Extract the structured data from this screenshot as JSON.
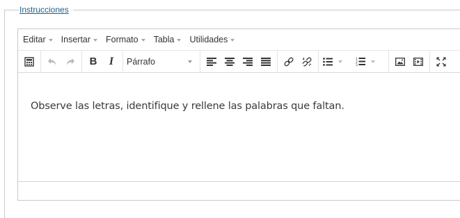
{
  "fieldset": {
    "legend": "Instrucciones"
  },
  "menubar": {
    "items": [
      {
        "label": "Editar"
      },
      {
        "label": "Insertar"
      },
      {
        "label": "Formato"
      },
      {
        "label": "Tabla"
      },
      {
        "label": "Utilidades"
      }
    ]
  },
  "toolbar": {
    "format_select_value": "Párrafo",
    "icons": {
      "source": "source-code-icon",
      "undo": "undo-icon",
      "redo": "redo-icon",
      "bold": "B",
      "italic": "I",
      "align_left": "align-left-icon",
      "align_center": "align-center-icon",
      "align_right": "align-right-icon",
      "align_justify": "align-justify-icon",
      "link": "link-icon",
      "unlink": "unlink-icon",
      "bullet_list": "bullet-list-icon",
      "numbered_list": "numbered-list-icon",
      "image": "image-icon",
      "media": "media-icon",
      "fullscreen": "fullscreen-icon"
    }
  },
  "editor": {
    "content": "Observe las letras, identifique y rellene las palabras que faltan."
  }
}
